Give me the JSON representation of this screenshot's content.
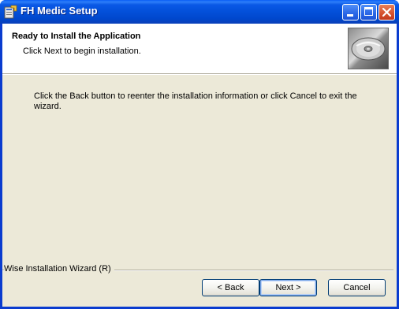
{
  "window": {
    "title": "FH Medic Setup"
  },
  "header": {
    "title": "Ready to Install the Application",
    "subtitle": "Click Next to begin installation."
  },
  "body": {
    "instructions": "Click the Back button to reenter the installation information or click Cancel to exit the wizard."
  },
  "footer": {
    "brand": "Wise Installation Wizard (R)"
  },
  "buttons": {
    "back": "< Back",
    "next": "Next >",
    "cancel": "Cancel"
  },
  "icons": {
    "app": "installer-icon",
    "header": "cd-disc-icon"
  },
  "colors": {
    "titlebar": "#0a58e6",
    "dialog_bg": "#ece9d8",
    "header_bg": "#ffffff"
  }
}
